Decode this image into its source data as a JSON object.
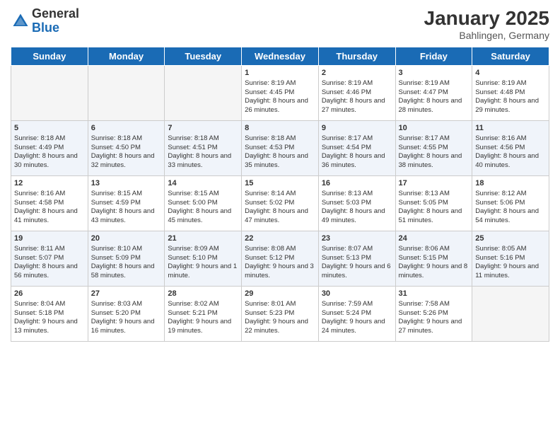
{
  "logo": {
    "general": "General",
    "blue": "Blue"
  },
  "header": {
    "month": "January 2025",
    "location": "Bahlingen, Germany"
  },
  "weekdays": [
    "Sunday",
    "Monday",
    "Tuesday",
    "Wednesday",
    "Thursday",
    "Friday",
    "Saturday"
  ],
  "rows": [
    {
      "class": "row-1",
      "cells": [
        {
          "empty": true
        },
        {
          "empty": true
        },
        {
          "empty": true
        },
        {
          "day": "1",
          "sunrise": "8:19 AM",
          "sunset": "4:45 PM",
          "daylight": "8 hours and 26 minutes."
        },
        {
          "day": "2",
          "sunrise": "8:19 AM",
          "sunset": "4:46 PM",
          "daylight": "8 hours and 27 minutes."
        },
        {
          "day": "3",
          "sunrise": "8:19 AM",
          "sunset": "4:47 PM",
          "daylight": "8 hours and 28 minutes."
        },
        {
          "day": "4",
          "sunrise": "8:19 AM",
          "sunset": "4:48 PM",
          "daylight": "8 hours and 29 minutes."
        }
      ]
    },
    {
      "class": "row-2",
      "cells": [
        {
          "day": "5",
          "sunrise": "8:18 AM",
          "sunset": "4:49 PM",
          "daylight": "8 hours and 30 minutes."
        },
        {
          "day": "6",
          "sunrise": "8:18 AM",
          "sunset": "4:50 PM",
          "daylight": "8 hours and 32 minutes."
        },
        {
          "day": "7",
          "sunrise": "8:18 AM",
          "sunset": "4:51 PM",
          "daylight": "8 hours and 33 minutes."
        },
        {
          "day": "8",
          "sunrise": "8:18 AM",
          "sunset": "4:53 PM",
          "daylight": "8 hours and 35 minutes."
        },
        {
          "day": "9",
          "sunrise": "8:17 AM",
          "sunset": "4:54 PM",
          "daylight": "8 hours and 36 minutes."
        },
        {
          "day": "10",
          "sunrise": "8:17 AM",
          "sunset": "4:55 PM",
          "daylight": "8 hours and 38 minutes."
        },
        {
          "day": "11",
          "sunrise": "8:16 AM",
          "sunset": "4:56 PM",
          "daylight": "8 hours and 40 minutes."
        }
      ]
    },
    {
      "class": "row-3",
      "cells": [
        {
          "day": "12",
          "sunrise": "8:16 AM",
          "sunset": "4:58 PM",
          "daylight": "8 hours and 41 minutes."
        },
        {
          "day": "13",
          "sunrise": "8:15 AM",
          "sunset": "4:59 PM",
          "daylight": "8 hours and 43 minutes."
        },
        {
          "day": "14",
          "sunrise": "8:15 AM",
          "sunset": "5:00 PM",
          "daylight": "8 hours and 45 minutes."
        },
        {
          "day": "15",
          "sunrise": "8:14 AM",
          "sunset": "5:02 PM",
          "daylight": "8 hours and 47 minutes."
        },
        {
          "day": "16",
          "sunrise": "8:13 AM",
          "sunset": "5:03 PM",
          "daylight": "8 hours and 49 minutes."
        },
        {
          "day": "17",
          "sunrise": "8:13 AM",
          "sunset": "5:05 PM",
          "daylight": "8 hours and 51 minutes."
        },
        {
          "day": "18",
          "sunrise": "8:12 AM",
          "sunset": "5:06 PM",
          "daylight": "8 hours and 54 minutes."
        }
      ]
    },
    {
      "class": "row-4",
      "cells": [
        {
          "day": "19",
          "sunrise": "8:11 AM",
          "sunset": "5:07 PM",
          "daylight": "8 hours and 56 minutes."
        },
        {
          "day": "20",
          "sunrise": "8:10 AM",
          "sunset": "5:09 PM",
          "daylight": "8 hours and 58 minutes."
        },
        {
          "day": "21",
          "sunrise": "8:09 AM",
          "sunset": "5:10 PM",
          "daylight": "9 hours and 1 minute."
        },
        {
          "day": "22",
          "sunrise": "8:08 AM",
          "sunset": "5:12 PM",
          "daylight": "9 hours and 3 minutes."
        },
        {
          "day": "23",
          "sunrise": "8:07 AM",
          "sunset": "5:13 PM",
          "daylight": "9 hours and 6 minutes."
        },
        {
          "day": "24",
          "sunrise": "8:06 AM",
          "sunset": "5:15 PM",
          "daylight": "9 hours and 8 minutes."
        },
        {
          "day": "25",
          "sunrise": "8:05 AM",
          "sunset": "5:16 PM",
          "daylight": "9 hours and 11 minutes."
        }
      ]
    },
    {
      "class": "row-5",
      "cells": [
        {
          "day": "26",
          "sunrise": "8:04 AM",
          "sunset": "5:18 PM",
          "daylight": "9 hours and 13 minutes."
        },
        {
          "day": "27",
          "sunrise": "8:03 AM",
          "sunset": "5:20 PM",
          "daylight": "9 hours and 16 minutes."
        },
        {
          "day": "28",
          "sunrise": "8:02 AM",
          "sunset": "5:21 PM",
          "daylight": "9 hours and 19 minutes."
        },
        {
          "day": "29",
          "sunrise": "8:01 AM",
          "sunset": "5:23 PM",
          "daylight": "9 hours and 22 minutes."
        },
        {
          "day": "30",
          "sunrise": "7:59 AM",
          "sunset": "5:24 PM",
          "daylight": "9 hours and 24 minutes."
        },
        {
          "day": "31",
          "sunrise": "7:58 AM",
          "sunset": "5:26 PM",
          "daylight": "9 hours and 27 minutes."
        },
        {
          "empty": true
        }
      ]
    }
  ]
}
